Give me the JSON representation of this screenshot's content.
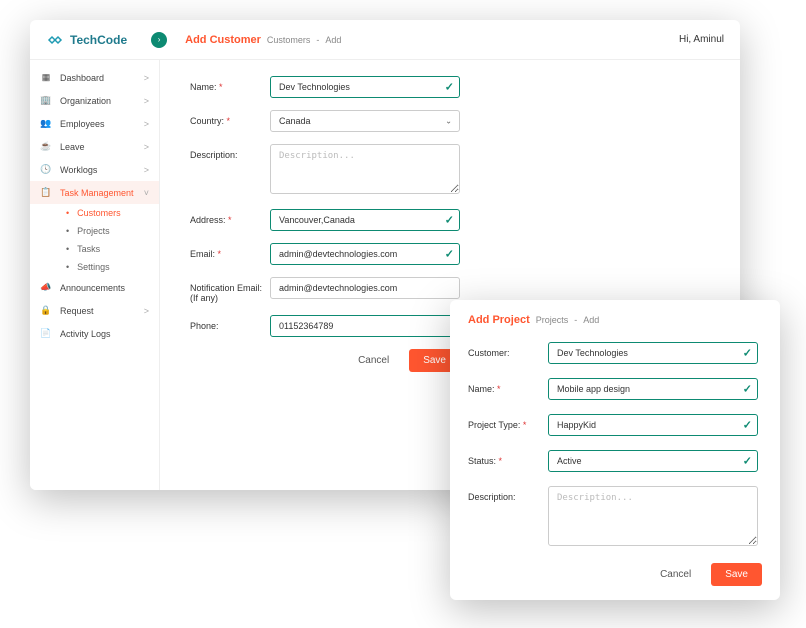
{
  "brand": "TechCode",
  "greeting": "Hi, Aminul",
  "sidebar": [
    {
      "icon": "▦",
      "label": "Dashboard",
      "chev": ">"
    },
    {
      "icon": "🏢",
      "label": "Organization",
      "chev": ">"
    },
    {
      "icon": "👥",
      "label": "Employees",
      "chev": ">"
    },
    {
      "icon": "☕",
      "label": "Leave",
      "chev": ">"
    },
    {
      "icon": "🕓",
      "label": "Worklogs",
      "chev": ">"
    },
    {
      "icon": "📋",
      "label": "Task Management",
      "chev": "˅",
      "active": true
    },
    {
      "icon": "📣",
      "label": "Announcements",
      "chev": ""
    },
    {
      "icon": "🔒",
      "label": "Request",
      "chev": ">"
    },
    {
      "icon": "📄",
      "label": "Activity Logs",
      "chev": ""
    }
  ],
  "submenu": [
    "Customers",
    "Projects",
    "Tasks",
    "Settings"
  ],
  "submenu_active": "Customers",
  "page1": {
    "title": "Add Customer",
    "crumb1": "Customers",
    "crumbsep": "-",
    "crumb2": "Add",
    "fields": {
      "name_lbl": "Name:",
      "name_val": "Dev Technologies",
      "country_lbl": "Country:",
      "country_val": "Canada",
      "desc_lbl": "Description:",
      "desc_ph": "Description...",
      "addr_lbl": "Address:",
      "addr_val": "Vancouver,Canada",
      "email_lbl": "Email:",
      "email_val": "admin@devtechnologies.com",
      "nemail_lbl": "Notification Email: (If any)",
      "nemail_val": "admin@devtechnologies.com",
      "phone_lbl": "Phone:",
      "phone_val": "01152364789"
    },
    "cancel": "Cancel",
    "save": "Save"
  },
  "page2": {
    "title": "Add Project",
    "crumb1": "Projects",
    "crumbsep": "-",
    "crumb2": "Add",
    "fields": {
      "cust_lbl": "Customer:",
      "cust_val": "Dev Technologies",
      "name_lbl": "Name:",
      "name_val": "Mobile app design",
      "type_lbl": "Project Type:",
      "type_val": "HappyKid",
      "status_lbl": "Status:",
      "status_val": "Active",
      "desc_lbl": "Description:",
      "desc_ph": "Description..."
    },
    "cancel": "Cancel",
    "save": "Save"
  }
}
